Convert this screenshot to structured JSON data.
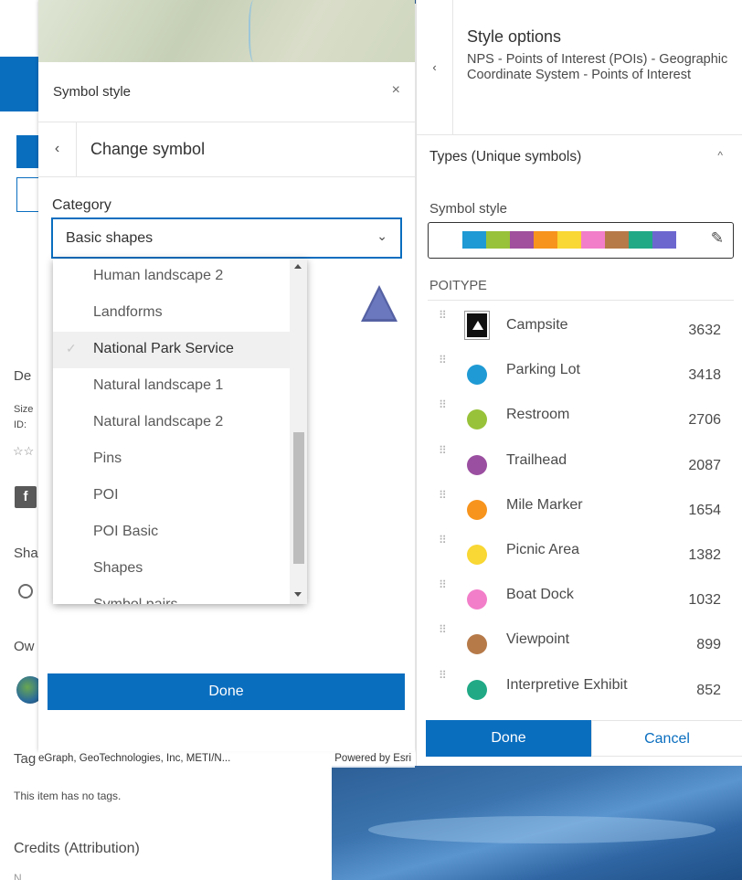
{
  "background_page": {
    "description_heading_partial": "De",
    "size_label_partial": "Size",
    "id_label_partial": "ID: ",
    "share_heading_partial": "Sha",
    "owner_heading_partial": "Ow",
    "tags_heading_partial": "Tag",
    "no_tags": "This item has no tags.",
    "credits_heading": "Credits (Attribution)",
    "credits_value_partial": "N..."
  },
  "symbol_panel": {
    "title": "Symbol style",
    "close_glyph": "×",
    "back_glyph": "‹",
    "subtitle": "Change symbol",
    "category_label": "Category",
    "category_selected": "Basic shapes",
    "select_chevron": "⌄",
    "dropdown_items": [
      {
        "label": "Human landscape 2",
        "selected": false
      },
      {
        "label": "Landforms",
        "selected": false
      },
      {
        "label": "National Park Service",
        "selected": true
      },
      {
        "label": "Natural landscape 1",
        "selected": false
      },
      {
        "label": "Natural landscape 2",
        "selected": false
      },
      {
        "label": "Pins",
        "selected": false
      },
      {
        "label": "POI",
        "selected": false
      },
      {
        "label": "POI Basic",
        "selected": false
      },
      {
        "label": "Shapes",
        "selected": false
      },
      {
        "label": "Symbol pairs",
        "selected": false
      }
    ],
    "check_glyph": "✓",
    "done_label": "Done"
  },
  "attribution": {
    "text": "eGraph, GeoTechnologies, Inc, METI/N...",
    "powered_by": "Powered by Esri"
  },
  "style_panel": {
    "back_glyph": "‹",
    "title": "Style options",
    "description": "NPS - Points of Interest (POIs) - Geographic Coordinate System - Points of Interest",
    "section_title": "Types (Unique symbols)",
    "section_chevron": "^",
    "symbol_style_label": "Symbol style",
    "ramp_colors": [
      "#1f9ad4",
      "#98c23a",
      "#a0509d",
      "#f7941d",
      "#f9d734",
      "#f27ec9",
      "#b67a49",
      "#21a986",
      "#6c67cf"
    ],
    "pencil_glyph": "✎",
    "field_label": "POITYPE",
    "grip_glyph": "⠿",
    "poi_types": [
      {
        "name": "Campsite",
        "count": "3632",
        "color": "#111111",
        "icon": "campsite-icon"
      },
      {
        "name": "Parking Lot",
        "count": "3418",
        "color": "#1f9ad4",
        "icon": "circle-icon"
      },
      {
        "name": "Restroom",
        "count": "2706",
        "color": "#98c23a",
        "icon": "circle-icon"
      },
      {
        "name": "Trailhead",
        "count": "2087",
        "color": "#9b4fa0",
        "icon": "circle-icon"
      },
      {
        "name": "Mile Marker",
        "count": "1654",
        "color": "#f7941d",
        "icon": "circle-icon"
      },
      {
        "name": "Picnic Area",
        "count": "1382",
        "color": "#f9d734",
        "icon": "circle-icon"
      },
      {
        "name": "Boat Dock",
        "count": "1032",
        "color": "#f27ec9",
        "icon": "circle-icon"
      },
      {
        "name": "Viewpoint",
        "count": "899",
        "color": "#b67a49",
        "icon": "circle-icon"
      },
      {
        "name": "Interpretive Exhibit",
        "count": "852",
        "color": "#21a986",
        "icon": "circle-icon"
      }
    ],
    "done_label": "Done",
    "cancel_label": "Cancel"
  }
}
